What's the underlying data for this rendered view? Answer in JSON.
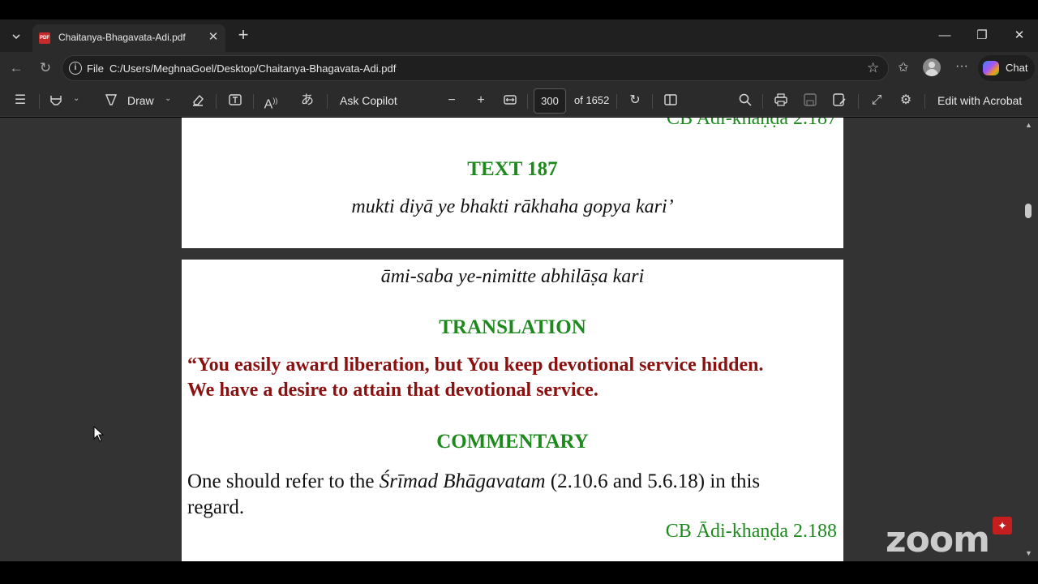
{
  "browser": {
    "tab": {
      "title": "Chaitanya-Bhagavata-Adi.pdf",
      "favicon": "pdf-icon"
    },
    "address": {
      "scheme_label": "File",
      "url": "C:/Users/MeghnaGoel/Desktop/Chaitanya-Bhagavata-Adi.pdf"
    },
    "chat_label": "Chat"
  },
  "toolbar": {
    "draw_label": "Draw",
    "ask_copilot_label": "Ask Copilot",
    "page_current": "300",
    "page_total_label": "of 1652",
    "edit_acrobat_label": "Edit with Acrobat"
  },
  "pdf": {
    "page1": {
      "ref_label": "CB Adi-khaṇḍa 2.187",
      "text_heading": "TEXT 187",
      "verse_line1": "mukti diyā ye bhakti rākhaha gopya kari’"
    },
    "page2": {
      "verse_line2": "āmi-saba ye-nimitte abhilāṣa kari",
      "translation_heading": "TRANSLATION",
      "translation_line1": "“You easily award liberation, but You keep devotional service hidden.",
      "translation_line2": "We have a desire to attain that devotional service.",
      "commentary_heading": "COMMENTARY",
      "commentary_pre": "One should refer to the ",
      "commentary_italic": "Śrīmad Bhāgavatam",
      "commentary_post": " (2.10.6 and 5.6.18) in this",
      "commentary_line2": "regard.",
      "ref_label_next": "CB Ādi-khaṇḍa 2.188"
    }
  },
  "overlay": {
    "watermark": "zoom"
  },
  "colors": {
    "heading_green": "#1e8a1e",
    "translation_maroon": "#8b1010",
    "viewer_bg": "#333333"
  }
}
